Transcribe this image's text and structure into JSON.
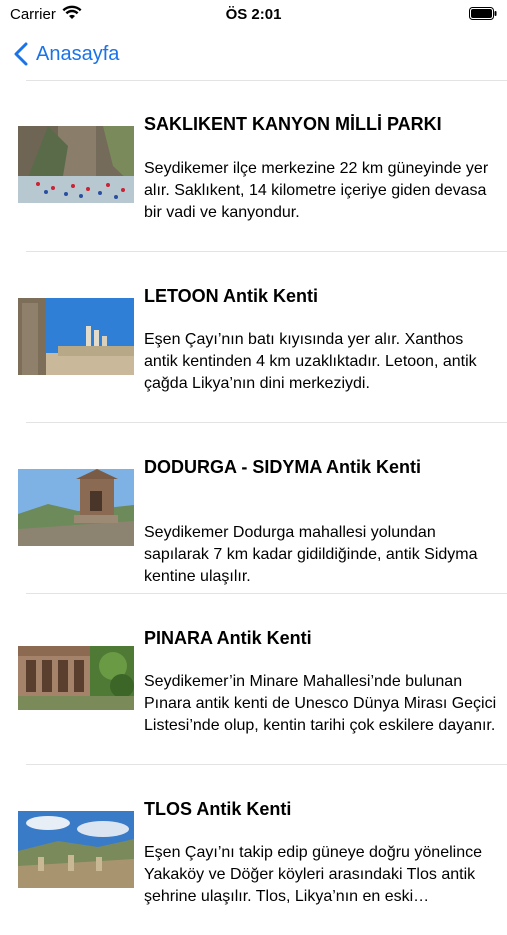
{
  "status": {
    "carrier": "Carrier",
    "time": "ÖS 2:01"
  },
  "nav": {
    "back_label": "Anasayfa"
  },
  "items": [
    {
      "title": "SAKLIKENT KANYON MİLLİ PARKI",
      "description": "Seydikemer ilçe merkezine 22 km güneyinde yer alır. Saklıkent, 14 kilometre içeriye giden devasa bir vadi ve kanyondur.",
      "image": "saklikent-canyon-photo"
    },
    {
      "title": "LETOON Antik Kenti",
      "description": "Eşen Çayı’nın batı kıyısında yer alır. Xanthos antik kentinden 4 km uzaklıktadır. Letoon, antik çağda Likya’nın dini merkeziydi.",
      "image": "letoon-ruins-photo"
    },
    {
      "title": "DODURGA - SIDYMA Antik Kenti",
      "description": "Seydikemer Dodurga mahallesi yolundan sapılarak 7 km kadar gidildiğinde, antik Sidyma kentine ulaşılır.",
      "image": "dodurga-tomb-photo"
    },
    {
      "title": "PINARA Antik Kenti",
      "description": "Seydikemer’in Minare Mahallesi’nde bulunan Pınara antik kenti de Unesco Dünya Mirası Geçici Listesi’nde olup, kentin tarihi çok eskilere dayanır.",
      "image": "pinara-rock-tombs-photo"
    },
    {
      "title": "TLOS Antik Kenti",
      "description": "Eşen Çayı’nı takip edip güneye doğru yönelince Yakaköy ve Döğer köyleri arasındaki Tlos antik şehrine ulaşılır. Tlos, Likya’nın en eski kentlerindendir.",
      "image": "tlos-ruins-photo"
    }
  ]
}
